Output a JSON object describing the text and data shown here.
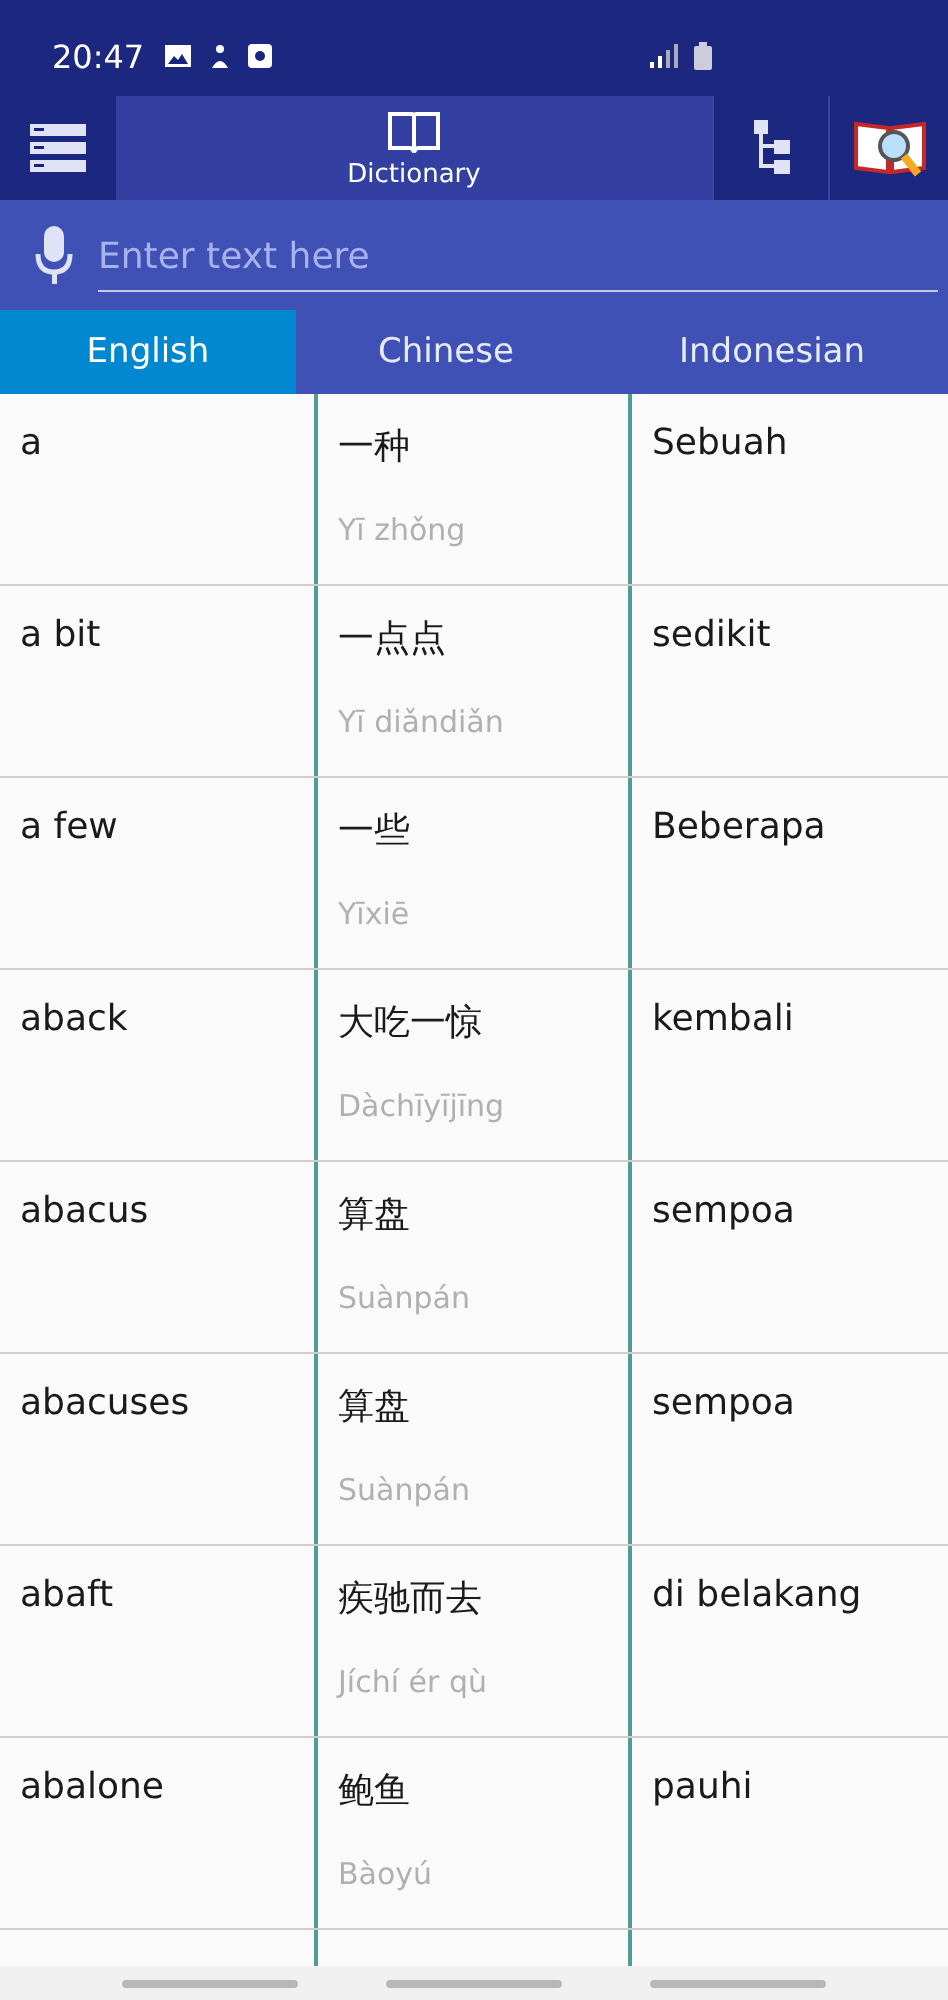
{
  "status_bar": {
    "time": "20:47"
  },
  "toolbar": {
    "tab_label": "Dictionary"
  },
  "search": {
    "placeholder": "Enter text here"
  },
  "tabs": [
    {
      "label": "English",
      "selected": true
    },
    {
      "label": "Chinese",
      "selected": false
    },
    {
      "label": "Indonesian",
      "selected": false
    }
  ],
  "rows": [
    {
      "english": "a",
      "chinese": "一种",
      "pinyin": "Yī zhǒng",
      "indonesian": "Sebuah"
    },
    {
      "english": "a bit",
      "chinese": "一点点",
      "pinyin": "Yī diǎndiǎn",
      "indonesian": "sedikit"
    },
    {
      "english": "a few",
      "chinese": "一些",
      "pinyin": "Yīxiē",
      "indonesian": "Beberapa"
    },
    {
      "english": "aback",
      "chinese": "大吃一惊",
      "pinyin": "Dàchīyījīng",
      "indonesian": "kembali"
    },
    {
      "english": "abacus",
      "chinese": "算盘",
      "pinyin": "Suànpán",
      "indonesian": "sempoa"
    },
    {
      "english": "abacuses",
      "chinese": "算盘",
      "pinyin": "Suànpán",
      "indonesian": "sempoa"
    },
    {
      "english": "abaft",
      "chinese": "疾驰而去",
      "pinyin": "Jíchí ér qù",
      "indonesian": "di belakang"
    },
    {
      "english": "abalone",
      "chinese": "鲍鱼",
      "pinyin": "Bàoyú",
      "indonesian": "pauhi"
    }
  ]
}
